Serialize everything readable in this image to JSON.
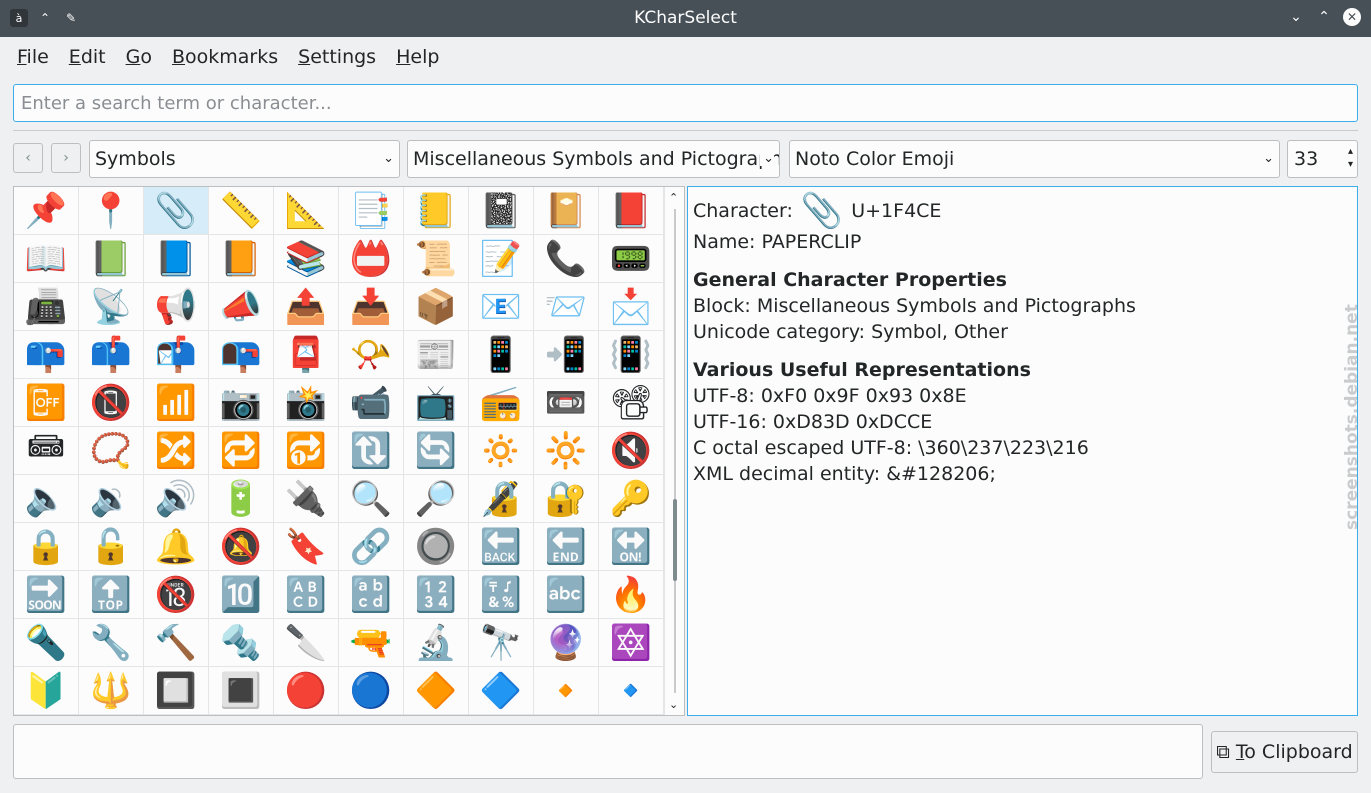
{
  "window": {
    "title": "KCharSelect",
    "app_icon": "à",
    "left_buttons": [
      "keep-above-icon",
      "pin-icon"
    ],
    "right_buttons": [
      "minimize-icon",
      "maximize-icon",
      "close-icon"
    ]
  },
  "menu": {
    "items": [
      {
        "label": "File",
        "accel": "F",
        "rest": "ile"
      },
      {
        "label": "Edit",
        "accel": "E",
        "rest": "dit"
      },
      {
        "label": "Go",
        "accel": "G",
        "rest": "o"
      },
      {
        "label": "Bookmarks",
        "accel": "B",
        "rest": "ookmarks"
      },
      {
        "label": "Settings",
        "accel": "S",
        "rest": "ettings"
      },
      {
        "label": "Help",
        "accel": "H",
        "rest": "elp"
      }
    ]
  },
  "search": {
    "placeholder": "Enter a search term or character...",
    "value": ""
  },
  "toolbar": {
    "back_icon": "‹",
    "forward_icon": "›",
    "section": "Symbols",
    "block": "Miscellaneous Symbols and Pictograph",
    "font": "Noto Color Emoji",
    "size": "33"
  },
  "grid": {
    "selected_index": 2,
    "cells": [
      "📌",
      "📍",
      "📎",
      "📏",
      "📐",
      "📑",
      "📒",
      "📓",
      "📔",
      "📕",
      "📖",
      "📗",
      "📘",
      "📙",
      "📚",
      "📛",
      "📜",
      "📝",
      "📞",
      "📟",
      "📠",
      "📡",
      "📢",
      "📣",
      "📤",
      "📥",
      "📦",
      "📧",
      "📨",
      "📩",
      "📪",
      "📫",
      "📬",
      "📭",
      "📮",
      "📯",
      "📰",
      "📱",
      "📲",
      "📳",
      "📴",
      "📵",
      "📶",
      "📷",
      "📸",
      "📹",
      "📺",
      "📻",
      "📼",
      "📽",
      "📾",
      "📿",
      "🔀",
      "🔁",
      "🔂",
      "🔃",
      "🔄",
      "🔅",
      "🔆",
      "🔇",
      "🔈",
      "🔉",
      "🔊",
      "🔋",
      "🔌",
      "🔍",
      "🔎",
      "🔏",
      "🔐",
      "🔑",
      "🔒",
      "🔓",
      "🔔",
      "🔕",
      "🔖",
      "🔗",
      "🔘",
      "🔙",
      "🔚",
      "🔛",
      "🔜",
      "🔝",
      "🔞",
      "🔟",
      "🔠",
      "🔡",
      "🔢",
      "🔣",
      "🔤",
      "🔥",
      "🔦",
      "🔧",
      "🔨",
      "🔩",
      "🔪",
      "🔫",
      "🔬",
      "🔭",
      "🔮",
      "🔯",
      "🔰",
      "🔱",
      "🔲",
      "🔳",
      "🔴",
      "🔵",
      "🔶",
      "🔷",
      "🔸",
      "🔹"
    ]
  },
  "info": {
    "character_label": "Character:",
    "character": "📎",
    "codepoint": "U+1F4CE",
    "name_line": "Name: PAPERCLIP",
    "general_header": "General Character Properties",
    "block_line": "Block: Miscellaneous Symbols and Pictographs",
    "category_line": "Unicode category: Symbol, Other",
    "useful_header": "Various Useful Representations",
    "utf8_line": "UTF-8: 0xF0 0x9F 0x93 0x8E",
    "utf16_line": "UTF-16: 0xD83D 0xDCCE",
    "octal_line": "C octal escaped UTF-8: \\360\\237\\223\\216",
    "xml_line": "XML decimal entity: &#128206;"
  },
  "bottom": {
    "text_value": "",
    "clipboard_prefix": "",
    "clipboard_accel": "T",
    "clipboard_rest": "o Clipboard"
  },
  "watermark": "screenshots.debian.net"
}
